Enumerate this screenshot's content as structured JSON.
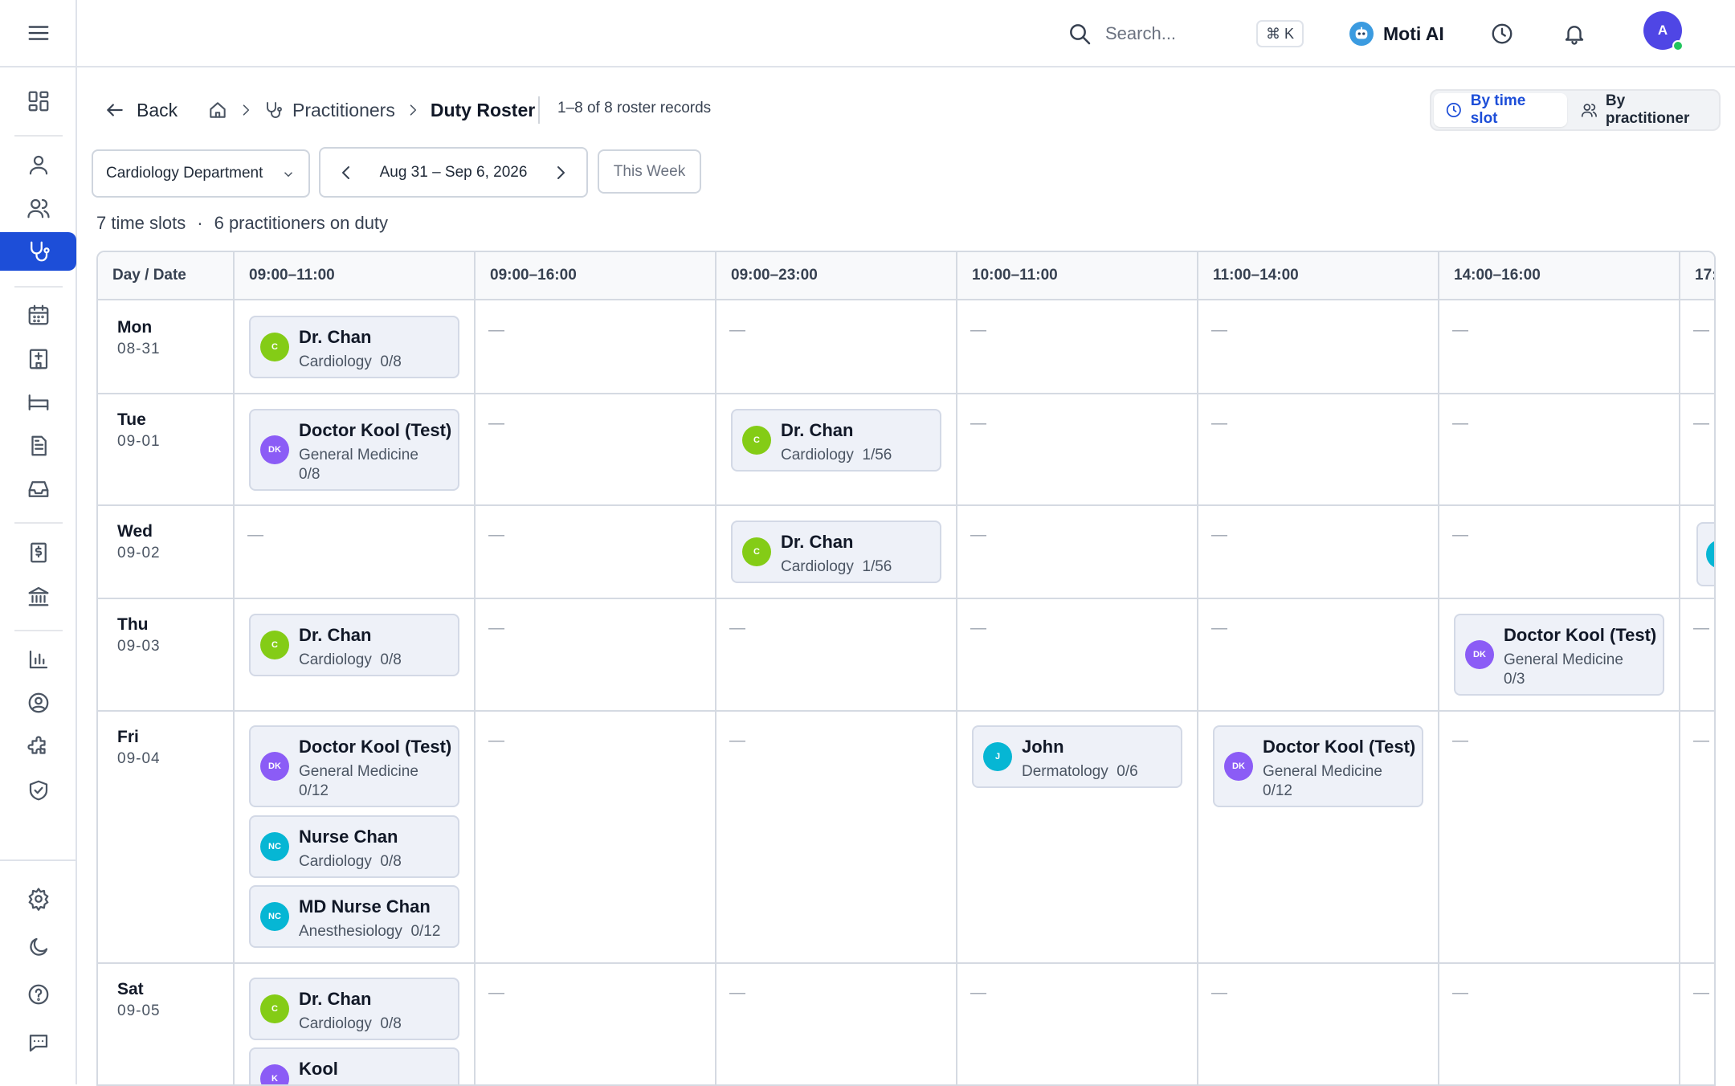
{
  "topbar": {
    "search_placeholder": "Search...",
    "shortcut": "⌘ K",
    "assistant_label": "Moti AI",
    "avatar_initial": "A"
  },
  "header": {
    "back_label": "Back",
    "breadcrumb": [
      "Practitioners",
      "Duty Roster"
    ],
    "records": "1–8 of 8 roster records",
    "view_by_time": "By time slot",
    "view_by_practitioner": "By practitioner"
  },
  "filters": {
    "department": "Cardiology Department",
    "week_range": "Aug 31 – Sep 6, 2026",
    "this_week": "This Week"
  },
  "summary": {
    "slots": "7 time slots",
    "separator": "·",
    "practitioners": "6 practitioners on duty"
  },
  "roster": {
    "corner_header": "Day / Date",
    "empty": "—",
    "slots": [
      "09:00–11:00",
      "09:00–16:00",
      "09:00–23:00",
      "10:00–11:00",
      "11:00–14:00",
      "14:00–16:00",
      "17:"
    ],
    "days": [
      {
        "name": "Mon",
        "date": "08-31"
      },
      {
        "name": "Tue",
        "date": "09-01"
      },
      {
        "name": "Wed",
        "date": "09-02"
      },
      {
        "name": "Thu",
        "date": "09-03"
      },
      {
        "name": "Fri",
        "date": "09-04"
      },
      {
        "name": "Sat",
        "date": "09-05"
      }
    ],
    "entries": {
      "mon_s1": {
        "initials": "C",
        "name": "Dr. Chan",
        "dept": "Cardiology",
        "count": "0/8",
        "color": "#84cc16"
      },
      "tue_s1": {
        "initials": "DK",
        "name": "Doctor Kool (Test)",
        "dept": "General Medicine",
        "count": "0/8",
        "color": "#8b5cf6"
      },
      "tue_s3": {
        "initials": "C",
        "name": "Dr. Chan",
        "dept": "Cardiology",
        "count": "1/56",
        "color": "#84cc16"
      },
      "wed_s3": {
        "initials": "C",
        "name": "Dr. Chan",
        "dept": "Cardiology",
        "count": "1/56",
        "color": "#84cc16"
      },
      "thu_s1": {
        "initials": "C",
        "name": "Dr. Chan",
        "dept": "Cardiology",
        "count": "0/8",
        "color": "#84cc16"
      },
      "thu_s6": {
        "initials": "DK",
        "name": "Doctor Kool (Test)",
        "dept": "General Medicine",
        "count": "0/3",
        "color": "#8b5cf6"
      },
      "fri_s1a": {
        "initials": "DK",
        "name": "Doctor Kool (Test)",
        "dept": "General Medicine",
        "count": "0/12",
        "color": "#8b5cf6"
      },
      "fri_s1b": {
        "initials": "NC",
        "name": "Nurse Chan",
        "dept": "Cardiology",
        "count": "0/8",
        "color": "#06b6d4"
      },
      "fri_s1c": {
        "initials": "NC",
        "name": "MD Nurse Chan",
        "dept": "Anesthesiology",
        "count": "0/12",
        "color": "#06b6d4"
      },
      "fri_s4": {
        "initials": "J",
        "name": "John",
        "dept": "Dermatology",
        "count": "0/6",
        "color": "#06b6d4"
      },
      "fri_s5": {
        "initials": "DK",
        "name": "Doctor Kool (Test)",
        "dept": "General Medicine",
        "count": "0/12",
        "color": "#8b5cf6"
      },
      "sat_s1a": {
        "initials": "C",
        "name": "Dr. Chan",
        "dept": "Cardiology",
        "count": "0/8",
        "color": "#84cc16"
      },
      "sat_s1b": {
        "initials": "K",
        "name": "Kool",
        "dept": "",
        "count": "",
        "color": "#8b5cf6"
      }
    },
    "wed_s7_color": "#06b6d4"
  },
  "colors": {
    "accent": "#1d4ed8",
    "status_online": "#22c55e"
  }
}
